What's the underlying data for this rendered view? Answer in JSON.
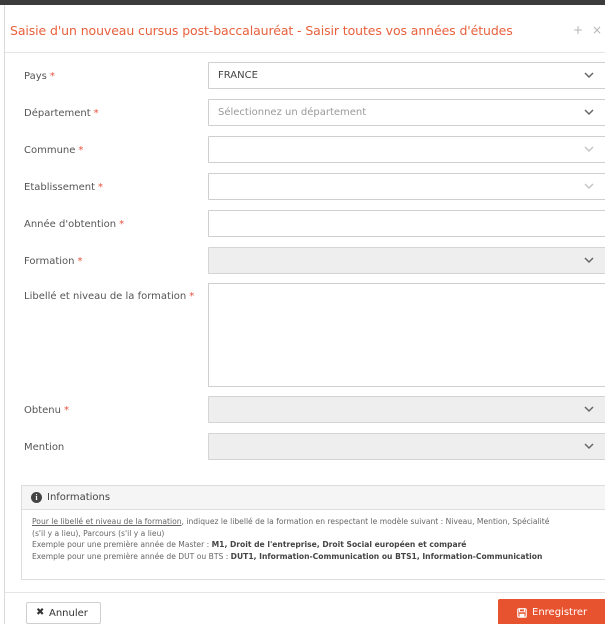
{
  "header": {
    "title": "Saisie d'un nouveau cursus post-baccalauréat - Saisir toutes vos années d'études",
    "plus_icon": "+",
    "close_icon": "×"
  },
  "form": {
    "required_mark": "*",
    "pays": {
      "label": "Pays",
      "value": "FRANCE"
    },
    "departement": {
      "label": "Département",
      "placeholder": "Sélectionnez un département"
    },
    "commune": {
      "label": "Commune",
      "value": ""
    },
    "etablissement": {
      "label": "Etablissement",
      "value": ""
    },
    "annee": {
      "label": "Année d'obtention",
      "value": ""
    },
    "formation": {
      "label": "Formation",
      "value": ""
    },
    "libelle": {
      "label": "Libellé et niveau de la formation",
      "value": ""
    },
    "obtenu": {
      "label": "Obtenu",
      "value": ""
    },
    "mention": {
      "label": "Mention",
      "value": ""
    }
  },
  "info": {
    "icon": "i",
    "title": "Informations",
    "line1_link": "Pour le libellé et niveau de la formation",
    "line1_text": ", indiquez le libellé de la formation en respectant le modèle suivant : Niveau, Mention, Spécialité",
    "line2": "(s'il y a lieu), Parcours (s'il y a lieu)",
    "line3_text": "Exemple pour une première année de Master : ",
    "line3_bold": "M1, Droit de l'entreprise, Droit Social européen et comparé",
    "line4_text": "Exemple pour une première année de DUT ou BTS : ",
    "line4_bold": "DUT1, Information-Communication ou BTS1, Information-Communication"
  },
  "buttons": {
    "cancel_icon": "✖",
    "cancel": "Annuler",
    "save": "Enregistrer"
  },
  "colors": {
    "accent": "#e8532f",
    "title": "#e8603c",
    "required": "#e8503c",
    "disabled_field": "#eeeeee"
  },
  "icons": {
    "dropdown": "chevron-down-icon",
    "close": "close-icon",
    "info": "info-icon",
    "save": "save-icon"
  }
}
